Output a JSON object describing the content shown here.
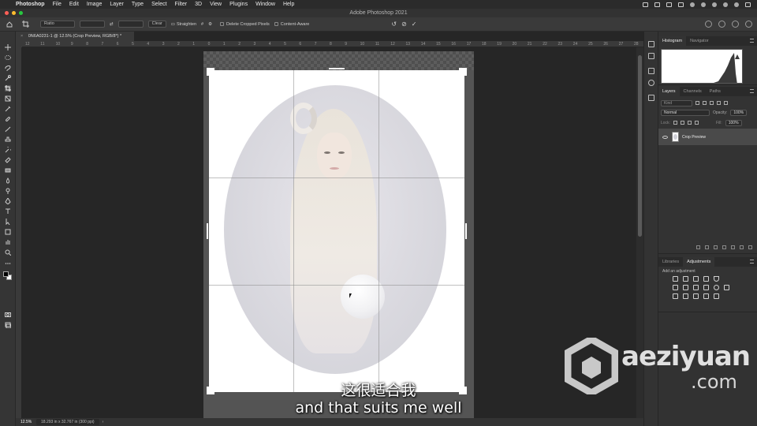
{
  "menubar": {
    "app": "Photoshop",
    "items": [
      "File",
      "Edit",
      "Image",
      "Layer",
      "Type",
      "Select",
      "Filter",
      "3D",
      "View",
      "Plugins",
      "Window",
      "Help"
    ]
  },
  "window": {
    "title": "Adobe Photoshop 2021"
  },
  "options": {
    "ratio": "Ratio",
    "clear": "Clear",
    "straighten": "Straighten",
    "delete_cropped": "Delete Cropped Pixels",
    "content_aware": "Content-Aware"
  },
  "document": {
    "tab": "0N6A0231-1 @ 12.5% (Crop Preview, RGB/8*) *"
  },
  "ruler": {
    "h_ticks": [
      "12",
      "11",
      "10",
      "9",
      "8",
      "7",
      "6",
      "5",
      "4",
      "3",
      "2",
      "1",
      "0",
      "1",
      "2",
      "3",
      "4",
      "5",
      "6",
      "7",
      "8",
      "9",
      "10",
      "11",
      "12",
      "13",
      "14",
      "15",
      "16",
      "17",
      "18",
      "19",
      "20",
      "21",
      "22",
      "23",
      "24",
      "25",
      "26",
      "27",
      "28"
    ]
  },
  "statusbar": {
    "zoom": "12.5%",
    "doc_info": "18.293 in x 32.767 in (300 ppi)"
  },
  "panels": {
    "top_tabs": [
      "Histogram",
      "Navigator"
    ],
    "layers_tabs": [
      "Layers",
      "Channels",
      "Paths"
    ],
    "kind_placeholder": "Kind",
    "blend_mode": "Normal",
    "opacity_label": "Opacity:",
    "opacity_value": "100%",
    "lock_label": "Lock:",
    "fill_label": "Fill:",
    "fill_value": "100%",
    "layer_name": "Crop Preview",
    "bottom_tabs": [
      "Libraries",
      "Adjustments"
    ],
    "adj_subtitle": "Add an adjustment"
  },
  "subtitles": {
    "cn": "这很适合我",
    "en": "and that suits me well"
  },
  "watermark": {
    "line1": "aeziyuan",
    "line2": ".com"
  },
  "colors": {
    "traffic_red": "#fe5f57",
    "traffic_yellow": "#febc2e",
    "traffic_green": "#28c840",
    "accent": "#4a4a4a"
  }
}
